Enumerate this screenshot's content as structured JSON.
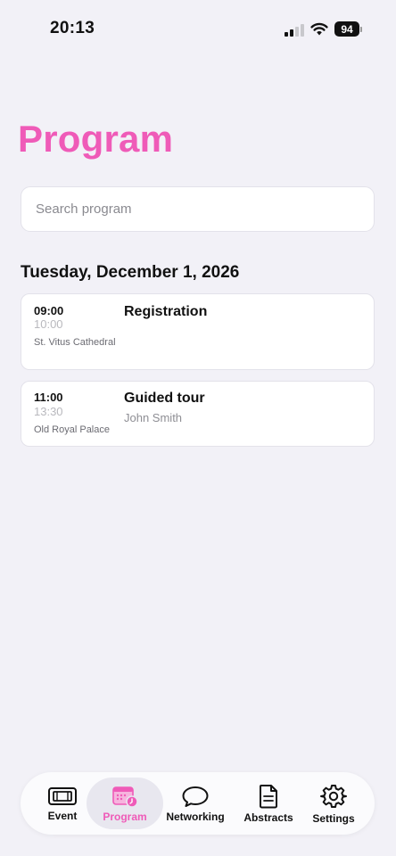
{
  "status_bar": {
    "time": "20:13",
    "battery": "94"
  },
  "page": {
    "title": "Program",
    "accent_color": "#ef5bb8"
  },
  "search": {
    "placeholder": "Search program",
    "value": ""
  },
  "day": {
    "date_label": "Tuesday, December 1, 2026"
  },
  "sessions": [
    {
      "start": "09:00",
      "end": "10:00",
      "location": "St. Vitus Cathedral",
      "title": "Registration",
      "speaker": ""
    },
    {
      "start": "11:00",
      "end": "13:30",
      "location": "Old Royal Palace",
      "title": "Guided tour",
      "speaker": "John Smith"
    }
  ],
  "tab_bar": {
    "active": "Program",
    "tabs": [
      {
        "label": "Event",
        "icon": "ticket-icon"
      },
      {
        "label": "Program",
        "icon": "calendar-clock-icon"
      },
      {
        "label": "Networking",
        "icon": "chat-bubble-icon"
      },
      {
        "label": "Abstracts",
        "icon": "document-icon"
      },
      {
        "label": "Settings",
        "icon": "gear-icon"
      }
    ]
  }
}
